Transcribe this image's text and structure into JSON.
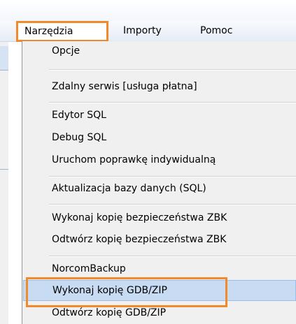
{
  "menubar": {
    "items": [
      {
        "label": "Narzędzia",
        "active": true
      },
      {
        "label": "Importy",
        "active": false
      },
      {
        "label": "Pomoc",
        "active": false
      }
    ]
  },
  "dropdown": {
    "items": [
      {
        "label": "Opcje"
      },
      {
        "label": "Zdalny serwis [usługa płatna]"
      },
      {
        "label": "Edytor SQL"
      },
      {
        "label": "Debug SQL"
      },
      {
        "label": "Uruchom poprawkę indywidualną"
      },
      {
        "label": "Aktualizacja bazy danych (SQL)"
      },
      {
        "label": "Wykonaj kopię bezpieczeństwa ZBK"
      },
      {
        "label": "Odtwórz kopię bezpieczeństwa ZBK"
      },
      {
        "label": "NorcomBackup"
      },
      {
        "label": "Wykonaj kopię GDB/ZIP",
        "selected": true
      },
      {
        "label": "Odtwórz kopię GDB/ZIP"
      }
    ]
  },
  "colors": {
    "highlight_outline": "#f08a2b",
    "selection_fill": "#c7dbf3",
    "menu_background": "#f0f0f0"
  }
}
